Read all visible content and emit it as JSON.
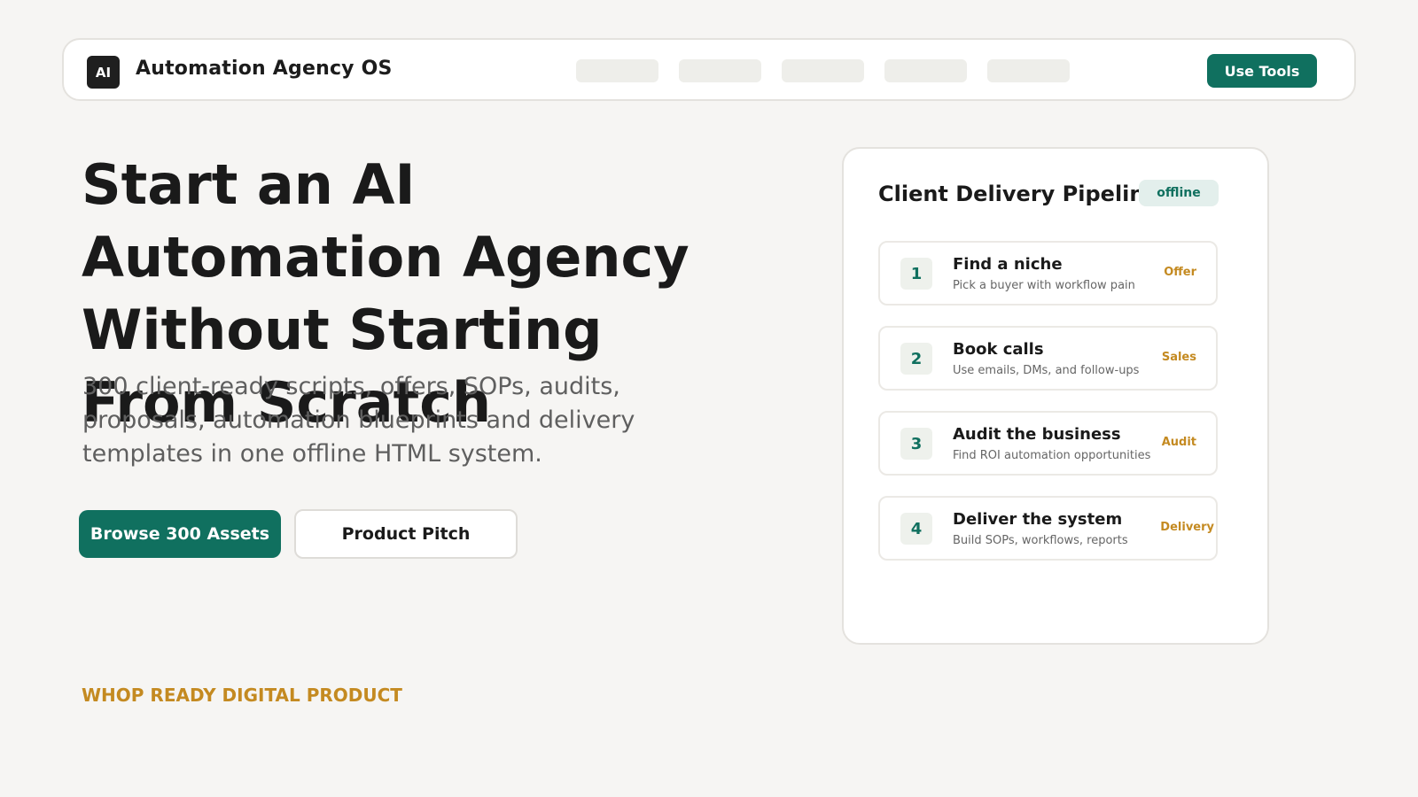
{
  "topbar": {
    "logo_text": "AI",
    "app_title": "Automation Agency OS",
    "nav_placeholders": 5,
    "cta_label": "Use Tools"
  },
  "hero": {
    "title": "Start an AI Automation Agency Without Starting From Scratch",
    "subtitle": "300 client-ready scripts, offers, SOPs, audits, proposals, automation blueprints and delivery templates in one offline HTML system.",
    "primary_button": "Browse 300 Assets",
    "secondary_button": "Product Pitch",
    "eyebrow": "WHOP READY DIGITAL PRODUCT"
  },
  "pipeline": {
    "title": "Client Delivery Pipeline",
    "status": "offline",
    "steps": [
      {
        "number": "1",
        "title": "Find a niche",
        "description": "Pick a buyer with workflow pain",
        "tag": "Offer"
      },
      {
        "number": "2",
        "title": "Book calls",
        "description": "Use emails, DMs, and follow-ups",
        "tag": "Sales"
      },
      {
        "number": "3",
        "title": "Audit the business",
        "description": "Find ROI automation opportunities",
        "tag": "Audit"
      },
      {
        "number": "4",
        "title": "Deliver the system",
        "description": "Build SOPs, workflows, reports",
        "tag": "Delivery"
      }
    ]
  },
  "colors": {
    "background": "#f6f5f3",
    "accent": "#10705f",
    "gold": "#c48a21",
    "text": "#1a1a1a"
  }
}
